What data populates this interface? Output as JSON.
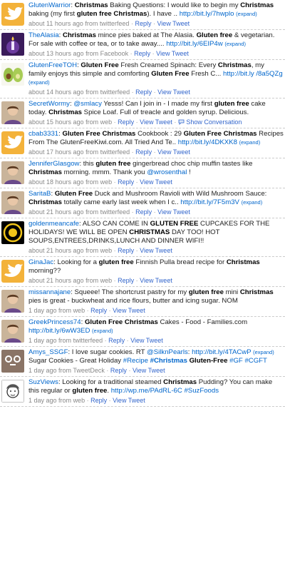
{
  "colors": {
    "link": "#0066cc",
    "meta": "#888888",
    "divider": "#cccccc",
    "twitter_bird": "#33ccff"
  },
  "tweets": [
    {
      "avatar": "twitter-bird-icon",
      "parts": [
        {
          "t": "u",
          "v": "GlutenWarrior"
        },
        {
          "t": "s",
          "v": ": "
        },
        {
          "t": "b",
          "v": "Christmas"
        },
        {
          "t": "s",
          "v": " Baking Questions: I would like to begin my "
        },
        {
          "t": "b",
          "v": "Christmas"
        },
        {
          "t": "s",
          "v": " baking (my first "
        },
        {
          "t": "b",
          "v": "gluten free Christmas"
        },
        {
          "t": "s",
          "v": "). I have .. "
        },
        {
          "t": "l",
          "v": "http://bit.ly/7hwplo"
        },
        {
          "t": "e",
          "v": "(expand)"
        }
      ],
      "time": "about 11 hours ago",
      "source": "twitterfeed",
      "actions": [
        "Reply",
        "View Tweet"
      ]
    },
    {
      "avatar": "candle-icon",
      "parts": [
        {
          "t": "u",
          "v": "TheAlasia"
        },
        {
          "t": "s",
          "v": ": "
        },
        {
          "t": "b",
          "v": "Christmas"
        },
        {
          "t": "s",
          "v": " mince pies baked at The Alasia. "
        },
        {
          "t": "b",
          "v": "Gluten free"
        },
        {
          "t": "s",
          "v": " & vegetarian. For sale with coffee or tea, or to take away.... "
        },
        {
          "t": "l",
          "v": "http://bit.ly/6EIP4w"
        },
        {
          "t": "e",
          "v": "(expand)"
        }
      ],
      "time": "about 13 hours ago",
      "source": "Facebook",
      "actions": [
        "Reply",
        "View Tweet"
      ]
    },
    {
      "avatar": "avocado-icon",
      "parts": [
        {
          "t": "u",
          "v": "GlutenFreeTOH"
        },
        {
          "t": "s",
          "v": ": "
        },
        {
          "t": "b",
          "v": "Gluten Free"
        },
        {
          "t": "s",
          "v": " Fresh Creamed Spinach: Every "
        },
        {
          "t": "b",
          "v": "Christmas"
        },
        {
          "t": "s",
          "v": ", my family enjoys this simple and comforting "
        },
        {
          "t": "b",
          "v": "Gluten Free"
        },
        {
          "t": "s",
          "v": " Fresh C... "
        },
        {
          "t": "l",
          "v": "http://bit.ly /8a5QZg"
        },
        {
          "t": "e",
          "v": "(expand)"
        }
      ],
      "time": "about 14 hours ago",
      "source": "twitterfeed",
      "actions": [
        "Reply",
        "View Tweet"
      ]
    },
    {
      "avatar": "user-photo-icon",
      "parts": [
        {
          "t": "u",
          "v": "SecretWormy"
        },
        {
          "t": "s",
          "v": ": "
        },
        {
          "t": "l",
          "v": "@smlacy"
        },
        {
          "t": "s",
          "v": " Yesss! Can I join in - I made my first "
        },
        {
          "t": "b",
          "v": "gluten free"
        },
        {
          "t": "s",
          "v": " cake today. "
        },
        {
          "t": "b",
          "v": "Christmas"
        },
        {
          "t": "s",
          "v": " Spice Loaf. Full of treacle and golden syrup. Delicious."
        }
      ],
      "time": "about 15 hours ago",
      "source": "web",
      "actions": [
        "Reply",
        "View Tweet",
        "Show Conversation"
      ]
    },
    {
      "avatar": "twitter-bird-icon",
      "parts": [
        {
          "t": "u",
          "v": "cbab3331"
        },
        {
          "t": "s",
          "v": ": "
        },
        {
          "t": "b",
          "v": "Gluten Free Christmas"
        },
        {
          "t": "s",
          "v": " Cookbook : 29 "
        },
        {
          "t": "b",
          "v": "Gluten Free Christmas"
        },
        {
          "t": "s",
          "v": " Recipes From The GlutenFreeKiwi.com. All Tried And Te.. "
        },
        {
          "t": "l",
          "v": "http://bit.ly/4DKXK8"
        },
        {
          "t": "e",
          "v": "(expand)"
        }
      ],
      "time": "about 17 hours ago",
      "source": "twitterfeed",
      "actions": [
        "Reply",
        "View Tweet"
      ]
    },
    {
      "avatar": "user-photo-icon",
      "parts": [
        {
          "t": "u",
          "v": "JenniferGlasgow"
        },
        {
          "t": "s",
          "v": ": this "
        },
        {
          "t": "b",
          "v": "gluten free"
        },
        {
          "t": "s",
          "v": " gingerbread choc chip muffin tastes like "
        },
        {
          "t": "b",
          "v": "Christmas"
        },
        {
          "t": "s",
          "v": " morning. mmm. Thank you "
        },
        {
          "t": "l",
          "v": "@wrosenthal"
        },
        {
          "t": "s",
          "v": " !"
        }
      ],
      "time": "about 18 hours ago",
      "source": "web",
      "actions": [
        "Reply",
        "View Tweet"
      ]
    },
    {
      "avatar": "user-photo-icon",
      "parts": [
        {
          "t": "u",
          "v": "SaritaB"
        },
        {
          "t": "s",
          "v": ": "
        },
        {
          "t": "b",
          "v": "Gluten Free"
        },
        {
          "t": "s",
          "v": " Duck and Mushroom Ravioli with Wild Mushroom Sauce: "
        },
        {
          "t": "b",
          "v": "Christmas"
        },
        {
          "t": "s",
          "v": " totally came early last week when I c.. "
        },
        {
          "t": "l",
          "v": "http://bit.ly/7F5m3V"
        },
        {
          "t": "e",
          "v": "(expand)"
        }
      ],
      "time": "about 21 hours ago",
      "source": "twitterfeed",
      "actions": [
        "Reply",
        "View Tweet"
      ]
    },
    {
      "avatar": "cafe-logo-icon",
      "parts": [
        {
          "t": "u",
          "v": "goldenmeancafe"
        },
        {
          "t": "s",
          "v": ": ALSO CAN COME IN "
        },
        {
          "t": "b",
          "v": "GLUTEN FREE"
        },
        {
          "t": "s",
          "v": " CUPCAKES FOR THE HOLIDAYS! WE WILL BE OPEN "
        },
        {
          "t": "b",
          "v": "CHRISTMAS"
        },
        {
          "t": "s",
          "v": " DAY TOO! HOT SOUPS,ENTREES,DRINKS,LUNCH AND DINNER WIFI!!"
        }
      ],
      "time": "about 21 hours ago",
      "source": "web",
      "actions": [
        "Reply",
        "View Tweet"
      ]
    },
    {
      "avatar": "twitter-bird-icon",
      "parts": [
        {
          "t": "u",
          "v": "GinaJac"
        },
        {
          "t": "s",
          "v": ": Looking for a "
        },
        {
          "t": "b",
          "v": "gluten free"
        },
        {
          "t": "s",
          "v": " Finnish Pulla bread recipe for "
        },
        {
          "t": "b",
          "v": "Christmas"
        },
        {
          "t": "s",
          "v": " morning??"
        }
      ],
      "time": "about 21 hours ago",
      "source": "web",
      "actions": [
        "Reply",
        "View Tweet"
      ]
    },
    {
      "avatar": "user-photo-icon",
      "parts": [
        {
          "t": "u",
          "v": "missannajane"
        },
        {
          "t": "s",
          "v": ": Squeee! The shortcrust pastry for my "
        },
        {
          "t": "b",
          "v": "gluten free"
        },
        {
          "t": "s",
          "v": " mini "
        },
        {
          "t": "b",
          "v": "Christmas"
        },
        {
          "t": "s",
          "v": " pies is great - buckwheat and rice flours, butter and icing sugar. NOM"
        }
      ],
      "time": "1 day ago",
      "source": "web",
      "actions": [
        "Reply",
        "View Tweet"
      ]
    },
    {
      "avatar": "user-photo-icon",
      "parts": [
        {
          "t": "u",
          "v": "GreekPrincess74"
        },
        {
          "t": "s",
          "v": ": "
        },
        {
          "t": "b",
          "v": "Gluten Free Christmas"
        },
        {
          "t": "s",
          "v": " Cakes - Food - Families.com "
        },
        {
          "t": "l",
          "v": "http://bit.ly/6wW3ED"
        },
        {
          "t": "e",
          "v": "(expand)"
        }
      ],
      "time": "1 day ago",
      "source": "twitterfeed",
      "actions": [
        "Reply",
        "View Tweet"
      ]
    },
    {
      "avatar": "emoticon-face-icon",
      "parts": [
        {
          "t": "u",
          "v": "Amys_SSGF"
        },
        {
          "t": "s",
          "v": ": I love sugar cookies. RT "
        },
        {
          "t": "l",
          "v": "@SilknPearls"
        },
        {
          "t": "s",
          "v": ": "
        },
        {
          "t": "l",
          "v": "http://bit.ly/4TACwP"
        },
        {
          "t": "e",
          "v": "(expand)"
        },
        {
          "t": "s",
          "v": " Sugar Cookies - Great Holiday "
        },
        {
          "t": "l",
          "v": "#Recipe"
        },
        {
          "t": "s",
          "v": " "
        },
        {
          "t": "lb",
          "v": "#Christmas"
        },
        {
          "t": "s",
          "v": " "
        },
        {
          "t": "b",
          "v": "Gluten-Free"
        },
        {
          "t": "s",
          "v": " "
        },
        {
          "t": "l",
          "v": "#GF"
        },
        {
          "t": "s",
          "v": " "
        },
        {
          "t": "l",
          "v": "#CGFT"
        }
      ],
      "time": "1 day ago",
      "source": "TweetDeck",
      "actions": [
        "Reply",
        "View Tweet"
      ]
    },
    {
      "avatar": "cartoon-portrait-icon",
      "parts": [
        {
          "t": "u",
          "v": "SuzViews"
        },
        {
          "t": "s",
          "v": ": Looking for a traditional steamed "
        },
        {
          "t": "b",
          "v": "Christmas"
        },
        {
          "t": "s",
          "v": " Pudding? You can make this regular or "
        },
        {
          "t": "b",
          "v": "gluten free"
        },
        {
          "t": "s",
          "v": ". "
        },
        {
          "t": "l",
          "v": "http://wp.me/PAdRL-6C"
        },
        {
          "t": "s",
          "v": " "
        },
        {
          "t": "l",
          "v": "#SuzFoods"
        }
      ],
      "time": "1 day ago",
      "source": "web",
      "actions": [
        "Reply",
        "View Tweet"
      ]
    }
  ]
}
